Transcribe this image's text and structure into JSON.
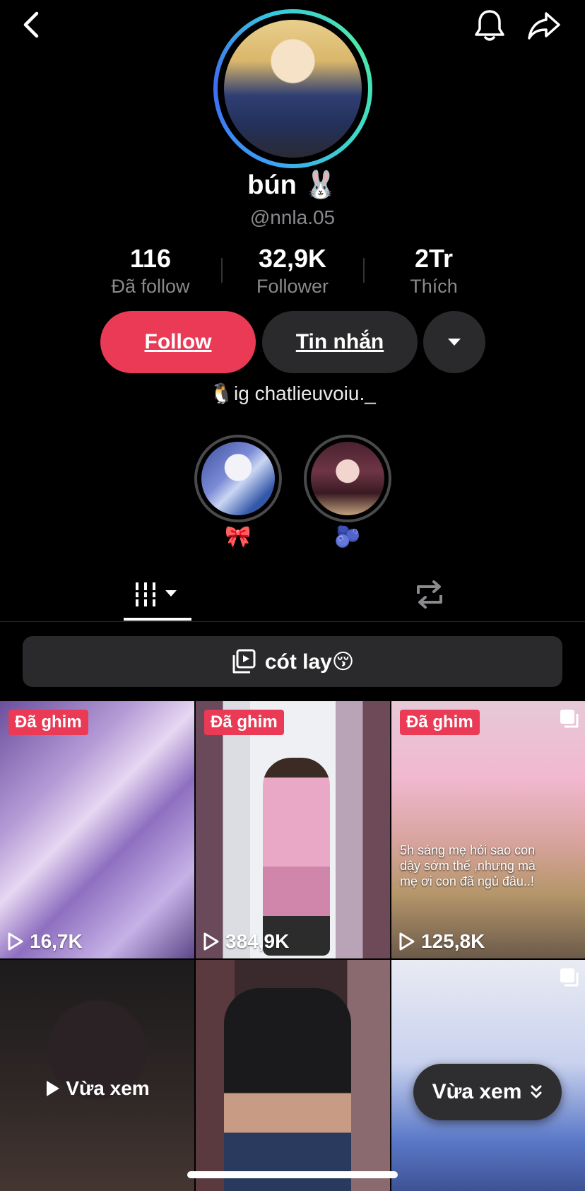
{
  "profile": {
    "username": "bún 🐰",
    "handle": "@nnla.05",
    "bio": "🐧ig chatlieuvoiu._"
  },
  "stats": [
    {
      "value": "116",
      "label": "Đã follow"
    },
    {
      "value": "32,9K",
      "label": "Follower"
    },
    {
      "value": "2Tr",
      "label": "Thích"
    }
  ],
  "actions": {
    "follow_label": "Follow",
    "message_label": "Tin nhắn"
  },
  "highlights": [
    {
      "emoji": "🎀"
    },
    {
      "emoji": "🫐"
    }
  ],
  "playlist": {
    "label": "cót lay😚"
  },
  "grid": [
    {
      "badge": "Đã ghim",
      "views": "16,7K"
    },
    {
      "badge": "Đã ghim",
      "views": "384,9K"
    },
    {
      "badge": "Đã ghim",
      "views": "125,8K",
      "caption": "5h sáng mẹ hỏi sao con dậy sớm thế ,nhưng mà mẹ ơi con đã ngủ đâu..!"
    },
    {
      "overlay": "Vừa xem"
    },
    {},
    {}
  ],
  "recently_watched_button": "Vừa xem",
  "icons": {
    "back": "chevron-left-icon",
    "bell": "bell-icon",
    "share": "share-icon",
    "more": "caret-down-icon",
    "videos_tab": "grid-bars-icon",
    "repost_tab": "repost-icon",
    "playlist": "playlist-icon",
    "play": "play-icon",
    "multi": "multi-photo-icon"
  },
  "colors": {
    "accent": "#ea3a55",
    "background": "#000000",
    "button_dark": "#2a2a2c",
    "muted_text": "#8a8a8e"
  }
}
